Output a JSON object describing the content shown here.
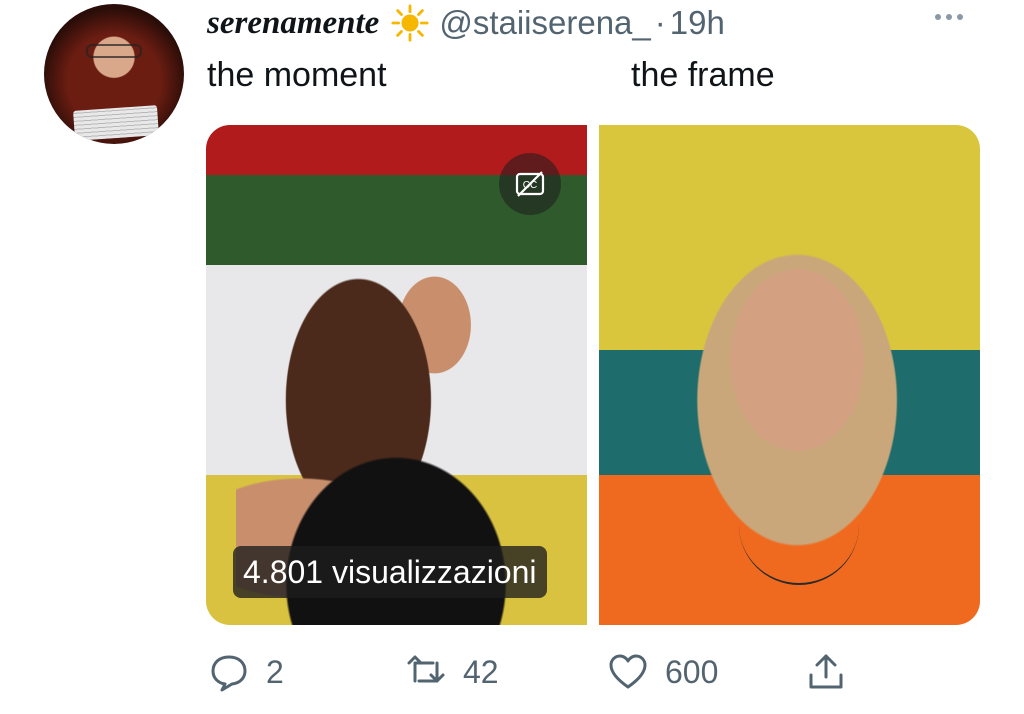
{
  "tweet": {
    "display_name": "serenamente",
    "emoji_icon": "sun-icon",
    "handle": "@staiiserena_",
    "separator": "·",
    "time": "19h",
    "caption_left": "the moment",
    "caption_right": "the frame"
  },
  "media": {
    "views": "4.801 visualizzazioni",
    "cc_icon": "captions-off-icon"
  },
  "actions": {
    "reply_count": "2",
    "retweet_count": "42",
    "like_count": "600"
  },
  "colors": {
    "text": "#0f1419",
    "secondary": "#536471",
    "sun": "#f5b700"
  }
}
